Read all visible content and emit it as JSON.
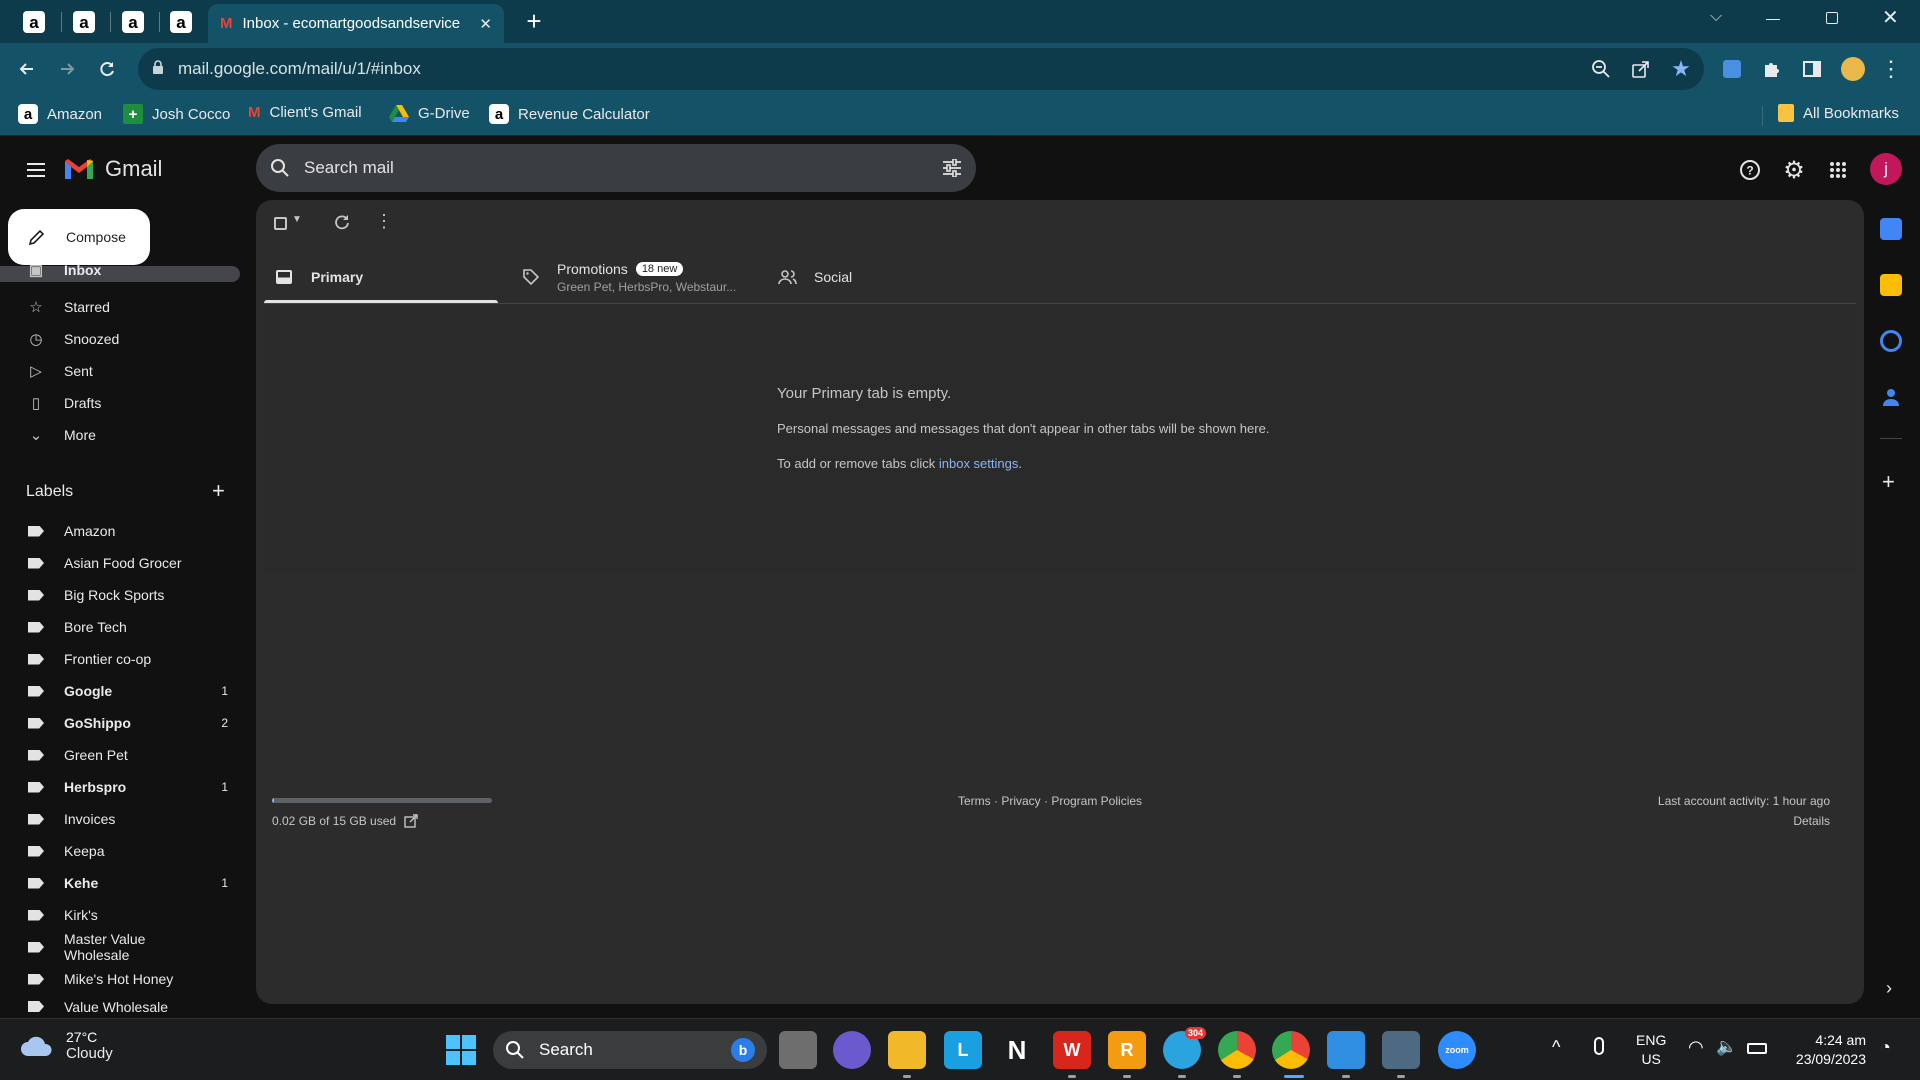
{
  "browser": {
    "mini_tabs": [
      "a",
      "a",
      "a",
      "a"
    ],
    "active_tab": {
      "title": "Inbox - ecomartgoodsandservice",
      "close": "✕"
    },
    "new_tab": "+",
    "url": "mail.google.com/mail/u/1/#inbox",
    "bookmarks": [
      {
        "label": "Amazon",
        "icon": "amazon-icon"
      },
      {
        "label": "Josh Cocco",
        "icon": "plus-green-icon"
      },
      {
        "label": "Client's Gmail",
        "icon": "gmail-icon"
      },
      {
        "label": "G-Drive",
        "icon": "drive-icon"
      },
      {
        "label": "Revenue Calculator",
        "icon": "amazon-icon"
      }
    ],
    "all_bookmarks": "All Bookmarks"
  },
  "gmail": {
    "logo_text": "Gmail",
    "search_placeholder": "Search mail",
    "avatar_letter": "j",
    "compose_label": "Compose",
    "nav": [
      {
        "label": "Inbox",
        "icon": "inbox-icon"
      },
      {
        "label": "Starred",
        "icon": "star-icon"
      },
      {
        "label": "Snoozed",
        "icon": "clock-icon"
      },
      {
        "label": "Sent",
        "icon": "send-icon"
      },
      {
        "label": "Drafts",
        "icon": "draft-icon"
      },
      {
        "label": "More",
        "icon": "chevron-down-icon"
      }
    ],
    "labels_heading": "Labels",
    "labels": [
      {
        "name": "Amazon",
        "count": "",
        "bold": false
      },
      {
        "name": "Asian Food Grocer",
        "count": "",
        "bold": false
      },
      {
        "name": "Big Rock Sports",
        "count": "",
        "bold": false
      },
      {
        "name": "Bore Tech",
        "count": "",
        "bold": false
      },
      {
        "name": "Frontier co-op",
        "count": "",
        "bold": false
      },
      {
        "name": "Google",
        "count": "1",
        "bold": true
      },
      {
        "name": "GoShippo",
        "count": "2",
        "bold": true
      },
      {
        "name": "Green Pet",
        "count": "",
        "bold": false
      },
      {
        "name": "Herbspro",
        "count": "1",
        "bold": true
      },
      {
        "name": "Invoices",
        "count": "",
        "bold": false
      },
      {
        "name": "Keepa",
        "count": "",
        "bold": false
      },
      {
        "name": "Kehe",
        "count": "1",
        "bold": true
      },
      {
        "name": "Kirk's",
        "count": "",
        "bold": false
      },
      {
        "name": "Master Value Wholesale",
        "count": "",
        "bold": false
      },
      {
        "name": "Mike's Hot Honey",
        "count": "",
        "bold": false
      },
      {
        "name": "Value Wholesale",
        "count": "",
        "bold": false
      }
    ],
    "tabs": {
      "primary": "Primary",
      "promotions": "Promotions",
      "promotions_badge": "18 new",
      "promotions_sub": "Green Pet, HerbsPro, Webstaur...",
      "social": "Social"
    },
    "empty": {
      "title": "Your Primary tab is empty.",
      "line1": "Personal messages and messages that don't appear in other tabs will be shown here.",
      "line2_prefix": "To add or remove tabs click ",
      "line2_link": "inbox settings",
      "line2_suffix": "."
    },
    "footer": {
      "storage": "0.02 GB of 15 GB used",
      "storage_fraction": 0.0013,
      "links": "Terms · Privacy · Program Policies",
      "activity": "Last account activity: 1 hour ago",
      "details": "Details"
    }
  },
  "taskbar": {
    "weather_temp": "27°C",
    "weather_desc": "Cloudy",
    "search_label": "Search",
    "telegram_badge": "304",
    "lang_top": "ENG",
    "lang_bottom": "US",
    "time": "4:24 am",
    "date": "23/09/2023",
    "zoom_label": "zoom"
  },
  "colors": {
    "chrome_frame": "#0e3b4b",
    "chrome_toolbar": "#145268",
    "gmail_bg": "#111111",
    "panel_bg": "#2c2c2c",
    "link": "#8ab4f8"
  }
}
